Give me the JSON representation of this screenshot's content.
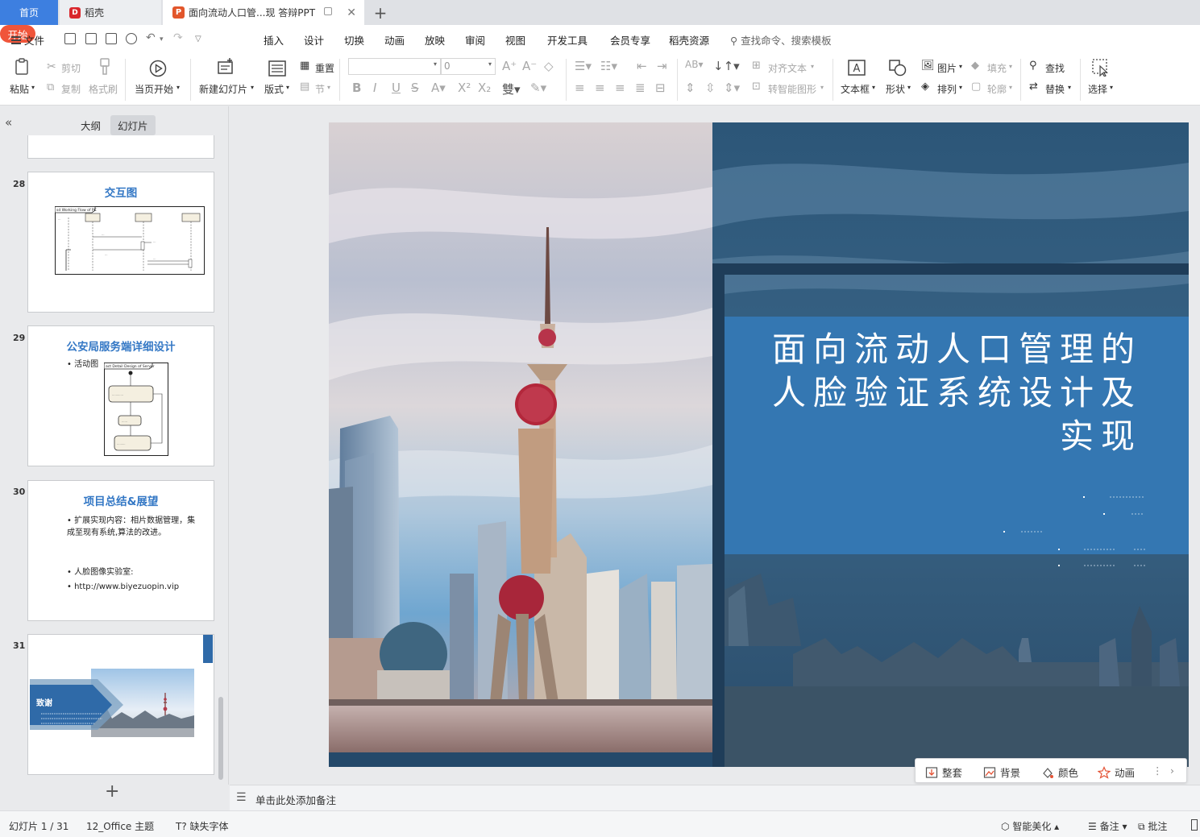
{
  "tabs": {
    "home": "首页",
    "docer": "稻壳",
    "document": "面向流动人口管...现 答辩PPT"
  },
  "menu": {
    "file": "文件",
    "items": [
      "开始",
      "插入",
      "设计",
      "切换",
      "动画",
      "放映",
      "审阅",
      "视图",
      "开发工具",
      "会员专享",
      "稻壳资源"
    ],
    "search": "查找命令、搜索模板"
  },
  "ribbon": {
    "paste": "粘贴",
    "cut": "剪切",
    "copy": "复制",
    "format_painter": "格式刷",
    "from_current": "当页开始",
    "new_slide": "新建幻灯片",
    "layout": "版式",
    "reset": "重置",
    "section": "节",
    "font_size": "0",
    "align_text": "对齐文本",
    "smart_art": "转智能图形",
    "text_box": "文本框",
    "shape": "形状",
    "picture": "图片",
    "arrange": "排列",
    "fill": "填充",
    "outline": "轮廓",
    "find": "查找",
    "replace": "替换",
    "select": "选择"
  },
  "left_panel": {
    "outline": "大纲",
    "slides": "幻灯片"
  },
  "thumbnails": [
    {
      "number": "28",
      "title": "交互图",
      "diagram_header": "sd Working Flow of PC",
      "diagram_lifelines": [
        "Camera\n移动端",
        "PC端",
        "服务器"
      ]
    },
    {
      "number": "29",
      "title": "公安局服务端详细设计",
      "bullet": "活动图",
      "diagram_header": "act Detail Design of Server"
    },
    {
      "number": "30",
      "title": "项目总结&展望",
      "bullets": [
        "扩展实现内容：相片数据管理，集成至现有系统,算法的改进。",
        "人脸图像实验室:",
        "http://www.biyezuopin.vip"
      ]
    },
    {
      "number": "31",
      "title": "致谢"
    }
  ],
  "slide": {
    "title": "面向流动人口管理的人脸验证系统设计及实现"
  },
  "quick_bar": {
    "items": [
      "整套",
      "背景",
      "颜色",
      "动画"
    ]
  },
  "notes": {
    "placeholder": "单击此处添加备注"
  },
  "status": {
    "slide_counter": "幻灯片 1 / 31",
    "theme": "12_Office 主题",
    "missing_font": "缺失字体",
    "smart_beautify": "智能美化",
    "notes": "备注",
    "comments": "批注"
  },
  "colors": {
    "accent_orange": "#f0553a",
    "home_tab_blue": "#3d7fe0",
    "slide_title_box": "#3477b2",
    "slide_dark_navy": "#24496a",
    "thumbnail_title_blue": "#3478c5"
  }
}
